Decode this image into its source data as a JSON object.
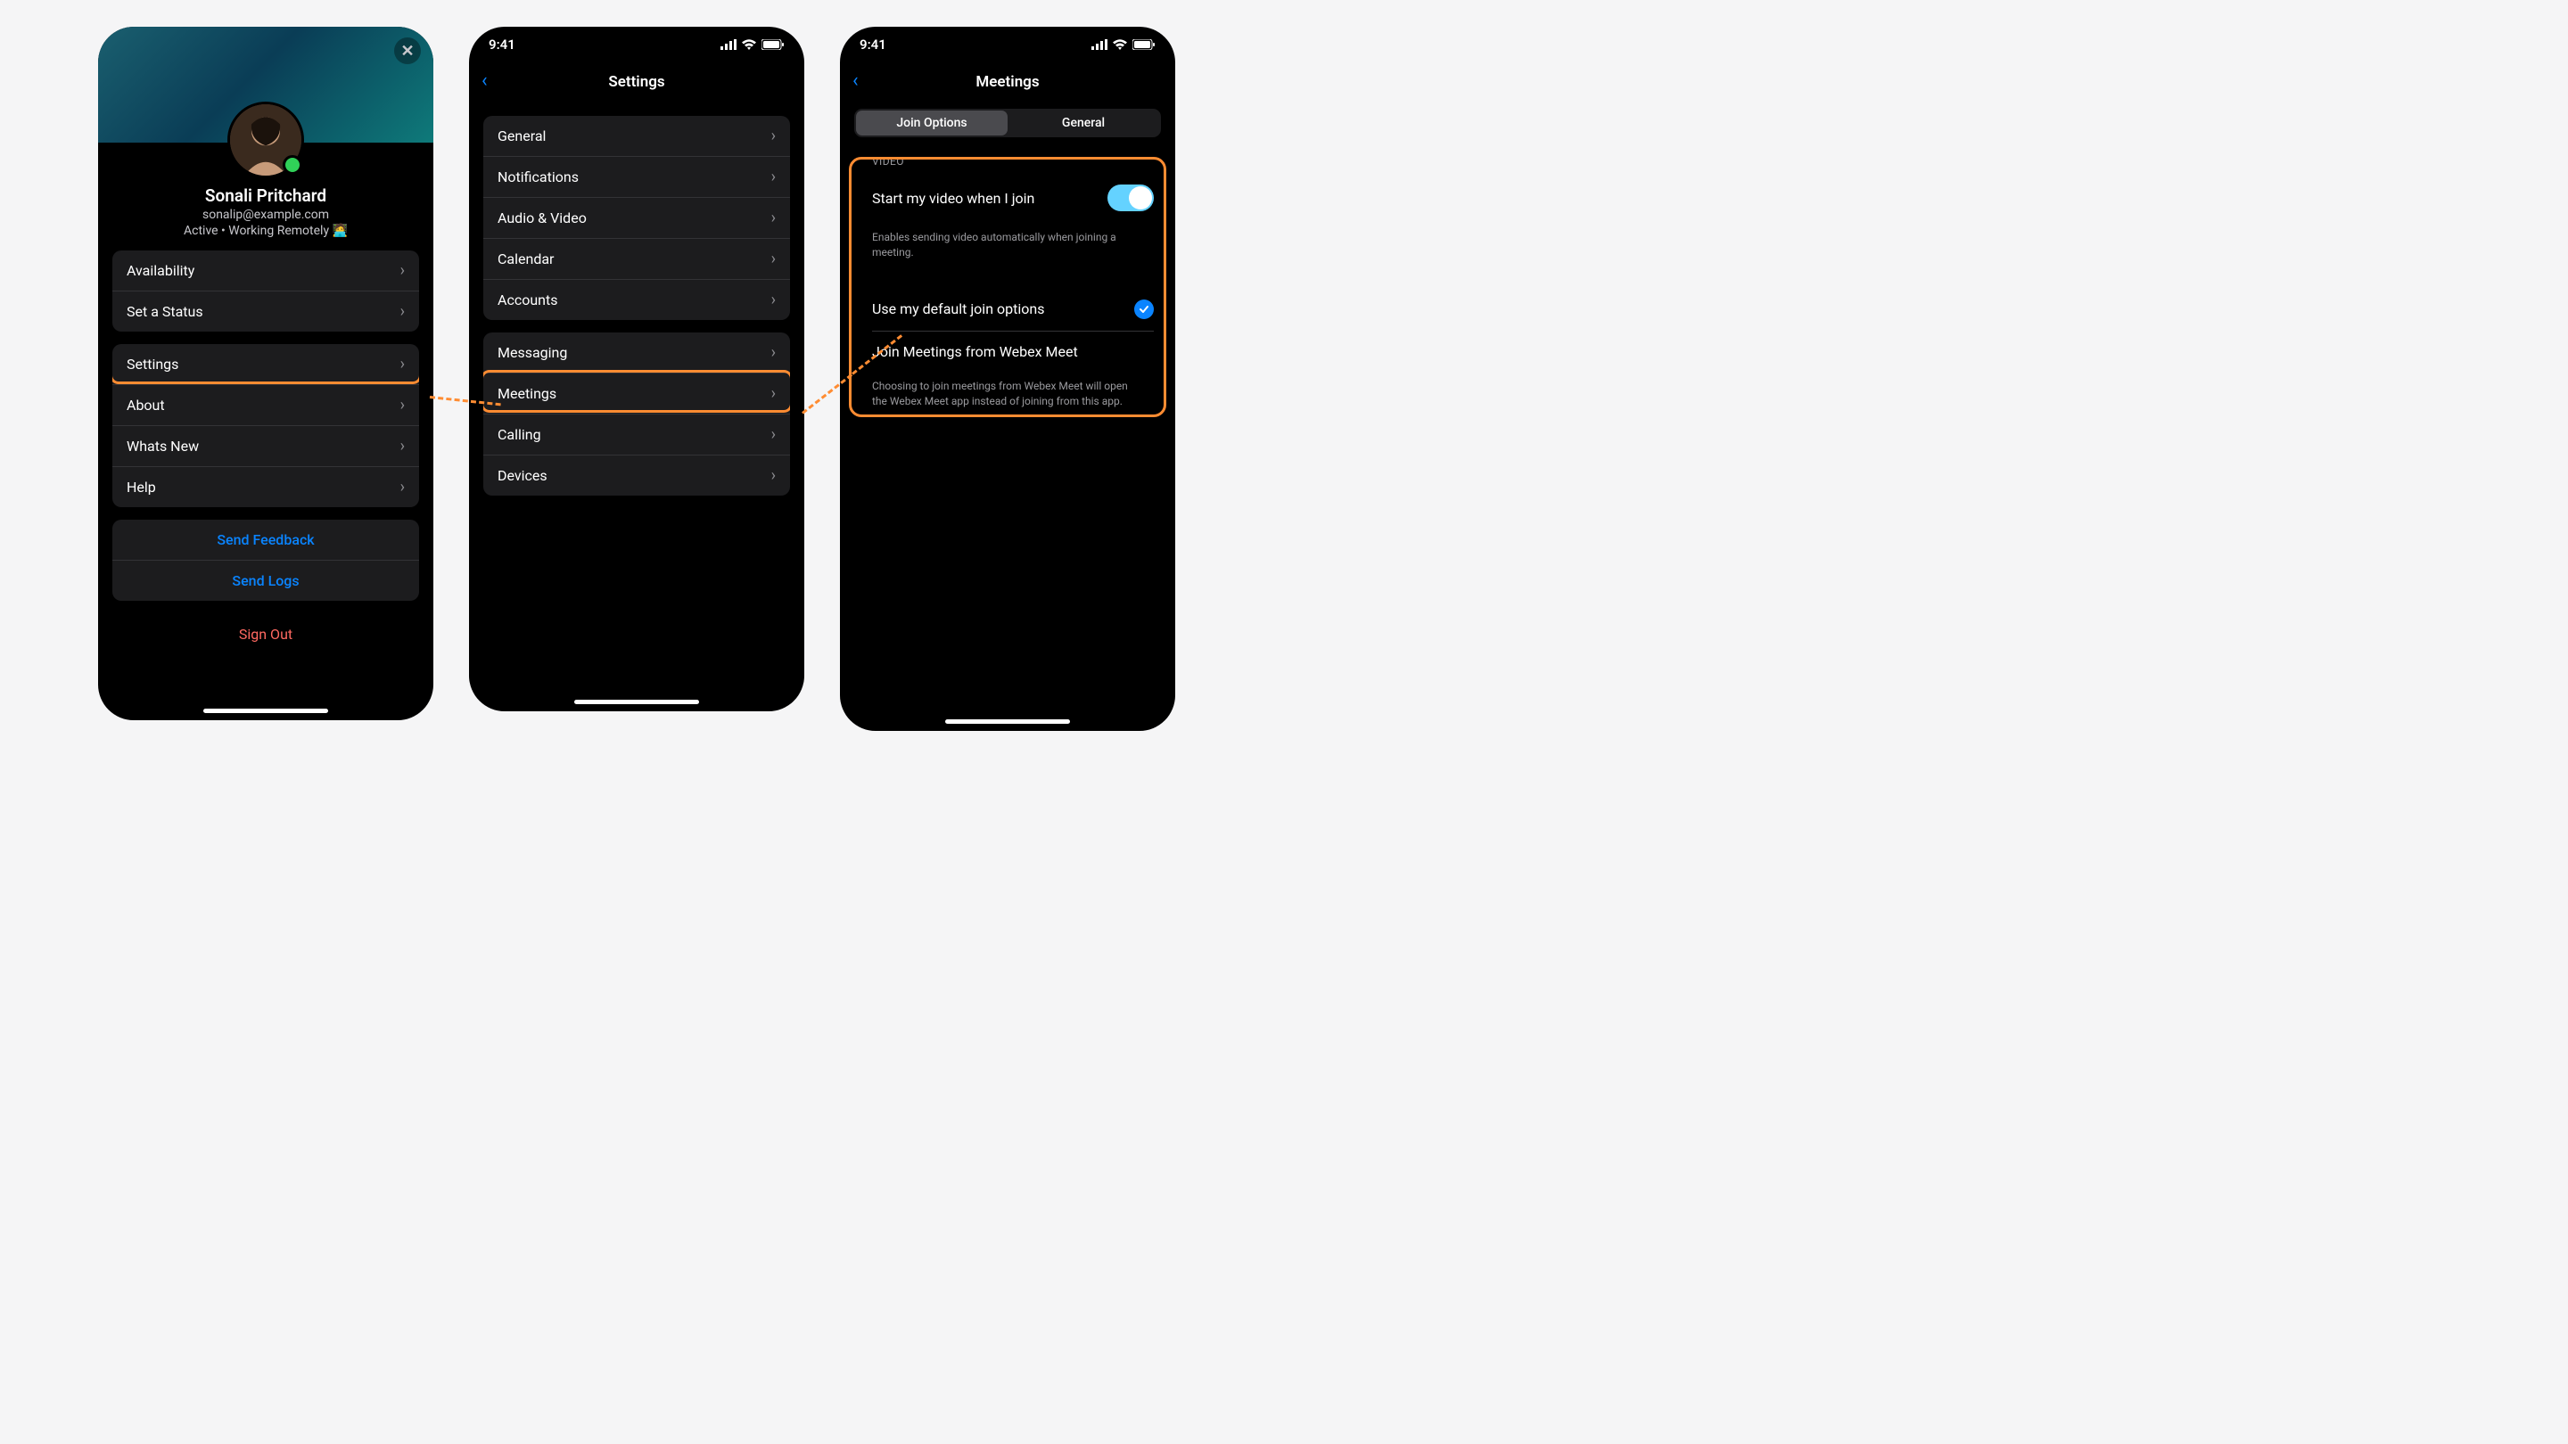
{
  "status": {
    "time": "9:41"
  },
  "screen1": {
    "user": {
      "name": "Sonali Pritchard",
      "email": "sonalip@example.com",
      "status": "Active • Working Remotely 🧑‍💻"
    },
    "group1": [
      {
        "label": "Availability"
      },
      {
        "label": "Set a Status"
      }
    ],
    "group2": [
      {
        "label": "Settings"
      },
      {
        "label": "About"
      },
      {
        "label": "Whats New"
      },
      {
        "label": "Help"
      }
    ],
    "group3": [
      {
        "label": "Send Feedback"
      },
      {
        "label": "Send Logs"
      }
    ],
    "signout": "Sign Out"
  },
  "screen2": {
    "title": "Settings",
    "groupA": [
      {
        "label": "General"
      },
      {
        "label": "Notifications"
      },
      {
        "label": "Audio & Video"
      },
      {
        "label": "Calendar"
      },
      {
        "label": "Accounts"
      }
    ],
    "groupB": [
      {
        "label": "Messaging"
      },
      {
        "label": "Meetings"
      },
      {
        "label": "Calling"
      },
      {
        "label": "Devices"
      }
    ]
  },
  "screen3": {
    "title": "Meetings",
    "tabs": {
      "a": "Join Options",
      "b": "General"
    },
    "video_header": "Video",
    "video_toggle_label": "Start my video when I join",
    "video_desc": "Enables sending video automatically when joining a meeting.",
    "opt_default": "Use my default join options",
    "opt_webex": "Join Meetings from Webex Meet",
    "webex_desc": "Choosing to join meetings from Webex Meet will open the Webex Meet app instead of joining from this app."
  }
}
